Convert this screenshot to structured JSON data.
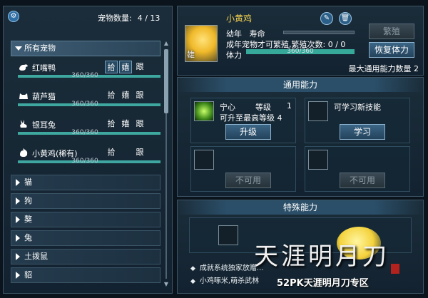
{
  "left": {
    "count_label": "宠物数量:",
    "count_value": "4 / 13",
    "all_pets_label": "所有宠物",
    "pets": [
      {
        "name": "红嘴鸭",
        "actions": [
          "拾",
          "嬉",
          "跟"
        ],
        "bar_text": "360/360",
        "fill": 1.0
      },
      {
        "name": "葫芦猫",
        "actions": [
          "拾",
          "嬉",
          "跟"
        ],
        "bar_text": "360/360",
        "fill": 1.0
      },
      {
        "name": "银耳兔",
        "actions": [
          "拾",
          "嬉",
          "跟"
        ],
        "bar_text": "360/360",
        "fill": 1.0
      },
      {
        "name": "小黄鸡(稀有)",
        "actions": [
          "拾",
          "",
          "跟"
        ],
        "bar_text": "360/360",
        "fill": 1.0
      }
    ],
    "categories": [
      "猫",
      "狗",
      "獒",
      "兔",
      "土拨鼠",
      "貂"
    ]
  },
  "info": {
    "pet_name": "小黄鸡",
    "gender": "雄",
    "life_label": "幼年",
    "lifespan_label": "寿命",
    "breed_text": "成年宠物才可繁殖,繁殖次数:",
    "breed_count": "0 / 0",
    "hp_label": "体力",
    "hp_text": "360/360",
    "hp_fill": 1.0,
    "breed_button": "繁殖",
    "restore_button": "恢复体力",
    "max_ability_label": "最大通用能力数量",
    "max_ability_value": "2",
    "edit_icon": "pencil-icon",
    "delete_icon": "trash-icon"
  },
  "general": {
    "title": "通用能力",
    "skill_name": "宁心",
    "level_label": "等级",
    "level_value": "1",
    "max_level_text": "可升至最高等级",
    "max_level_value": "4",
    "upgrade_button": "升级",
    "learn_text": "可学习新技能",
    "learn_button": "学习",
    "unavailable_1": "不可用",
    "unavailable_2": "不可用"
  },
  "special": {
    "title": "特殊能力",
    "line1": "成就系统独家放赠...",
    "line2": "小鸡啄米,萌杀武林"
  },
  "watermark": {
    "calligraphy": "天涯明月刀",
    "caption": "52PK天涯明月刀专区"
  }
}
